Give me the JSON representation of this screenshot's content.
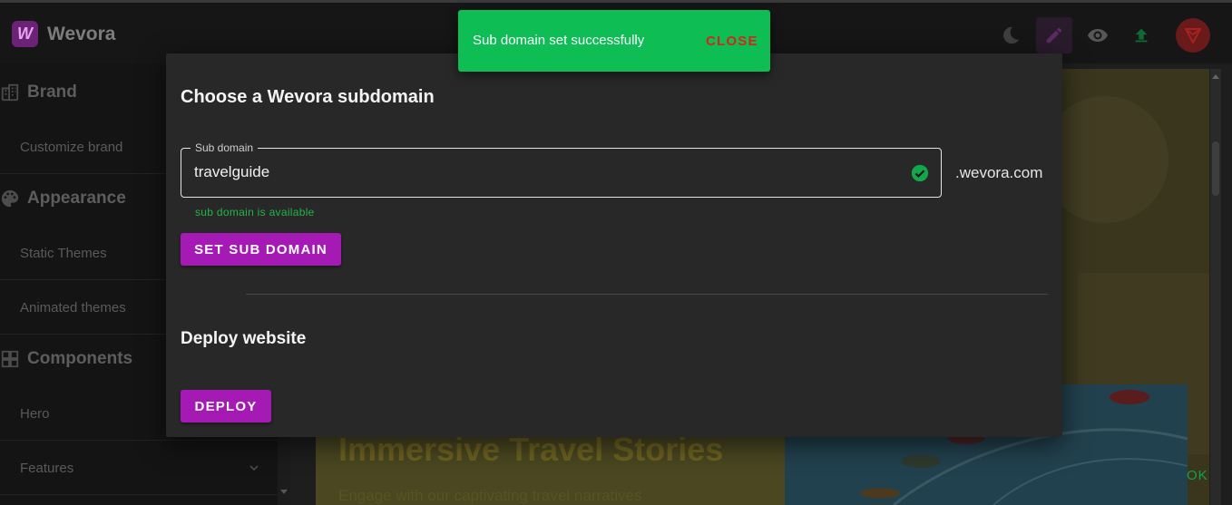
{
  "app": {
    "name": "Wevora",
    "logo_letter": "W"
  },
  "toolbar": {
    "icons": [
      "moon-icon",
      "pencil-icon",
      "eye-icon",
      "upload-icon"
    ],
    "accent": "#a51ab5"
  },
  "sidebar": {
    "sections": [
      {
        "label": "Brand",
        "icon": "building-icon"
      },
      {
        "label": "Appearance",
        "icon": "palette-icon"
      },
      {
        "label": "Components",
        "icon": "grid-icon"
      }
    ],
    "items": [
      {
        "label": "Customize brand"
      },
      {
        "label": "Static Themes"
      },
      {
        "label": "Animated themes"
      },
      {
        "label": "Hero"
      },
      {
        "label": "Features"
      }
    ]
  },
  "preview": {
    "hero_title": "Immersive Travel Stories",
    "hero_subtitle": "Engage with our captivating travel narratives",
    "ok_label": "OK"
  },
  "dialog": {
    "title": "Choose a Wevora subdomain",
    "subdomain": {
      "label": "Sub domain",
      "value": "travelguide",
      "suffix": ".wevora.com",
      "helper": "sub domain is available",
      "status": "valid"
    },
    "set_button_label": "SET SUB DOMAIN",
    "deploy_title": "Deploy website",
    "deploy_button_label": "DEPLOY"
  },
  "snackbar": {
    "message": "Sub domain set successfully",
    "action_label": "CLOSE",
    "color": "#0ebe55"
  }
}
